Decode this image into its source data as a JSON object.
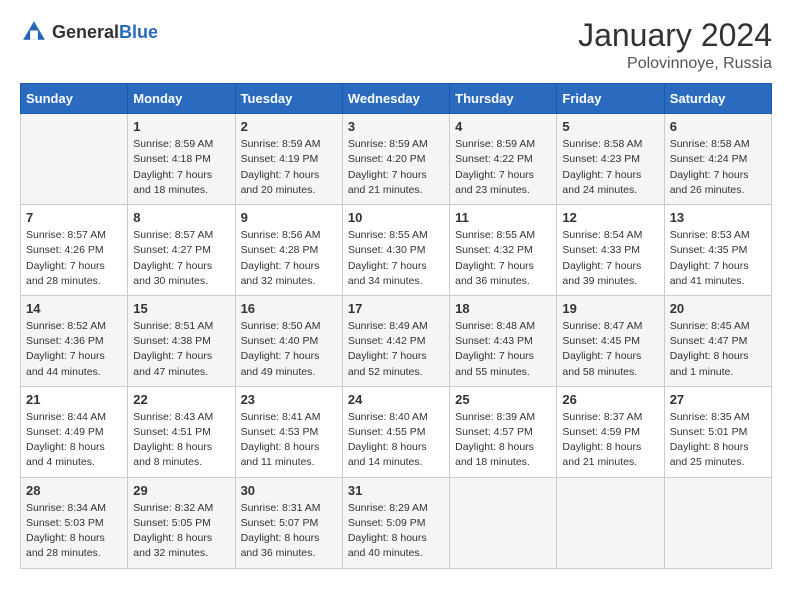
{
  "header": {
    "logo_general": "General",
    "logo_blue": "Blue",
    "title": "January 2024",
    "subtitle": "Polovinnoye, Russia"
  },
  "days_of_week": [
    "Sunday",
    "Monday",
    "Tuesday",
    "Wednesday",
    "Thursday",
    "Friday",
    "Saturday"
  ],
  "weeks": [
    [
      {
        "day": "",
        "sunrise": "",
        "sunset": "",
        "daylight": ""
      },
      {
        "day": "1",
        "sunrise": "Sunrise: 8:59 AM",
        "sunset": "Sunset: 4:18 PM",
        "daylight": "Daylight: 7 hours and 18 minutes."
      },
      {
        "day": "2",
        "sunrise": "Sunrise: 8:59 AM",
        "sunset": "Sunset: 4:19 PM",
        "daylight": "Daylight: 7 hours and 20 minutes."
      },
      {
        "day": "3",
        "sunrise": "Sunrise: 8:59 AM",
        "sunset": "Sunset: 4:20 PM",
        "daylight": "Daylight: 7 hours and 21 minutes."
      },
      {
        "day": "4",
        "sunrise": "Sunrise: 8:59 AM",
        "sunset": "Sunset: 4:22 PM",
        "daylight": "Daylight: 7 hours and 23 minutes."
      },
      {
        "day": "5",
        "sunrise": "Sunrise: 8:58 AM",
        "sunset": "Sunset: 4:23 PM",
        "daylight": "Daylight: 7 hours and 24 minutes."
      },
      {
        "day": "6",
        "sunrise": "Sunrise: 8:58 AM",
        "sunset": "Sunset: 4:24 PM",
        "daylight": "Daylight: 7 hours and 26 minutes."
      }
    ],
    [
      {
        "day": "7",
        "sunrise": "Sunrise: 8:57 AM",
        "sunset": "Sunset: 4:26 PM",
        "daylight": "Daylight: 7 hours and 28 minutes."
      },
      {
        "day": "8",
        "sunrise": "Sunrise: 8:57 AM",
        "sunset": "Sunset: 4:27 PM",
        "daylight": "Daylight: 7 hours and 30 minutes."
      },
      {
        "day": "9",
        "sunrise": "Sunrise: 8:56 AM",
        "sunset": "Sunset: 4:28 PM",
        "daylight": "Daylight: 7 hours and 32 minutes."
      },
      {
        "day": "10",
        "sunrise": "Sunrise: 8:55 AM",
        "sunset": "Sunset: 4:30 PM",
        "daylight": "Daylight: 7 hours and 34 minutes."
      },
      {
        "day": "11",
        "sunrise": "Sunrise: 8:55 AM",
        "sunset": "Sunset: 4:32 PM",
        "daylight": "Daylight: 7 hours and 36 minutes."
      },
      {
        "day": "12",
        "sunrise": "Sunrise: 8:54 AM",
        "sunset": "Sunset: 4:33 PM",
        "daylight": "Daylight: 7 hours and 39 minutes."
      },
      {
        "day": "13",
        "sunrise": "Sunrise: 8:53 AM",
        "sunset": "Sunset: 4:35 PM",
        "daylight": "Daylight: 7 hours and 41 minutes."
      }
    ],
    [
      {
        "day": "14",
        "sunrise": "Sunrise: 8:52 AM",
        "sunset": "Sunset: 4:36 PM",
        "daylight": "Daylight: 7 hours and 44 minutes."
      },
      {
        "day": "15",
        "sunrise": "Sunrise: 8:51 AM",
        "sunset": "Sunset: 4:38 PM",
        "daylight": "Daylight: 7 hours and 47 minutes."
      },
      {
        "day": "16",
        "sunrise": "Sunrise: 8:50 AM",
        "sunset": "Sunset: 4:40 PM",
        "daylight": "Daylight: 7 hours and 49 minutes."
      },
      {
        "day": "17",
        "sunrise": "Sunrise: 8:49 AM",
        "sunset": "Sunset: 4:42 PM",
        "daylight": "Daylight: 7 hours and 52 minutes."
      },
      {
        "day": "18",
        "sunrise": "Sunrise: 8:48 AM",
        "sunset": "Sunset: 4:43 PM",
        "daylight": "Daylight: 7 hours and 55 minutes."
      },
      {
        "day": "19",
        "sunrise": "Sunrise: 8:47 AM",
        "sunset": "Sunset: 4:45 PM",
        "daylight": "Daylight: 7 hours and 58 minutes."
      },
      {
        "day": "20",
        "sunrise": "Sunrise: 8:45 AM",
        "sunset": "Sunset: 4:47 PM",
        "daylight": "Daylight: 8 hours and 1 minute."
      }
    ],
    [
      {
        "day": "21",
        "sunrise": "Sunrise: 8:44 AM",
        "sunset": "Sunset: 4:49 PM",
        "daylight": "Daylight: 8 hours and 4 minutes."
      },
      {
        "day": "22",
        "sunrise": "Sunrise: 8:43 AM",
        "sunset": "Sunset: 4:51 PM",
        "daylight": "Daylight: 8 hours and 8 minutes."
      },
      {
        "day": "23",
        "sunrise": "Sunrise: 8:41 AM",
        "sunset": "Sunset: 4:53 PM",
        "daylight": "Daylight: 8 hours and 11 minutes."
      },
      {
        "day": "24",
        "sunrise": "Sunrise: 8:40 AM",
        "sunset": "Sunset: 4:55 PM",
        "daylight": "Daylight: 8 hours and 14 minutes."
      },
      {
        "day": "25",
        "sunrise": "Sunrise: 8:39 AM",
        "sunset": "Sunset: 4:57 PM",
        "daylight": "Daylight: 8 hours and 18 minutes."
      },
      {
        "day": "26",
        "sunrise": "Sunrise: 8:37 AM",
        "sunset": "Sunset: 4:59 PM",
        "daylight": "Daylight: 8 hours and 21 minutes."
      },
      {
        "day": "27",
        "sunrise": "Sunrise: 8:35 AM",
        "sunset": "Sunset: 5:01 PM",
        "daylight": "Daylight: 8 hours and 25 minutes."
      }
    ],
    [
      {
        "day": "28",
        "sunrise": "Sunrise: 8:34 AM",
        "sunset": "Sunset: 5:03 PM",
        "daylight": "Daylight: 8 hours and 28 minutes."
      },
      {
        "day": "29",
        "sunrise": "Sunrise: 8:32 AM",
        "sunset": "Sunset: 5:05 PM",
        "daylight": "Daylight: 8 hours and 32 minutes."
      },
      {
        "day": "30",
        "sunrise": "Sunrise: 8:31 AM",
        "sunset": "Sunset: 5:07 PM",
        "daylight": "Daylight: 8 hours and 36 minutes."
      },
      {
        "day": "31",
        "sunrise": "Sunrise: 8:29 AM",
        "sunset": "Sunset: 5:09 PM",
        "daylight": "Daylight: 8 hours and 40 minutes."
      },
      {
        "day": "",
        "sunrise": "",
        "sunset": "",
        "daylight": ""
      },
      {
        "day": "",
        "sunrise": "",
        "sunset": "",
        "daylight": ""
      },
      {
        "day": "",
        "sunrise": "",
        "sunset": "",
        "daylight": ""
      }
    ]
  ]
}
